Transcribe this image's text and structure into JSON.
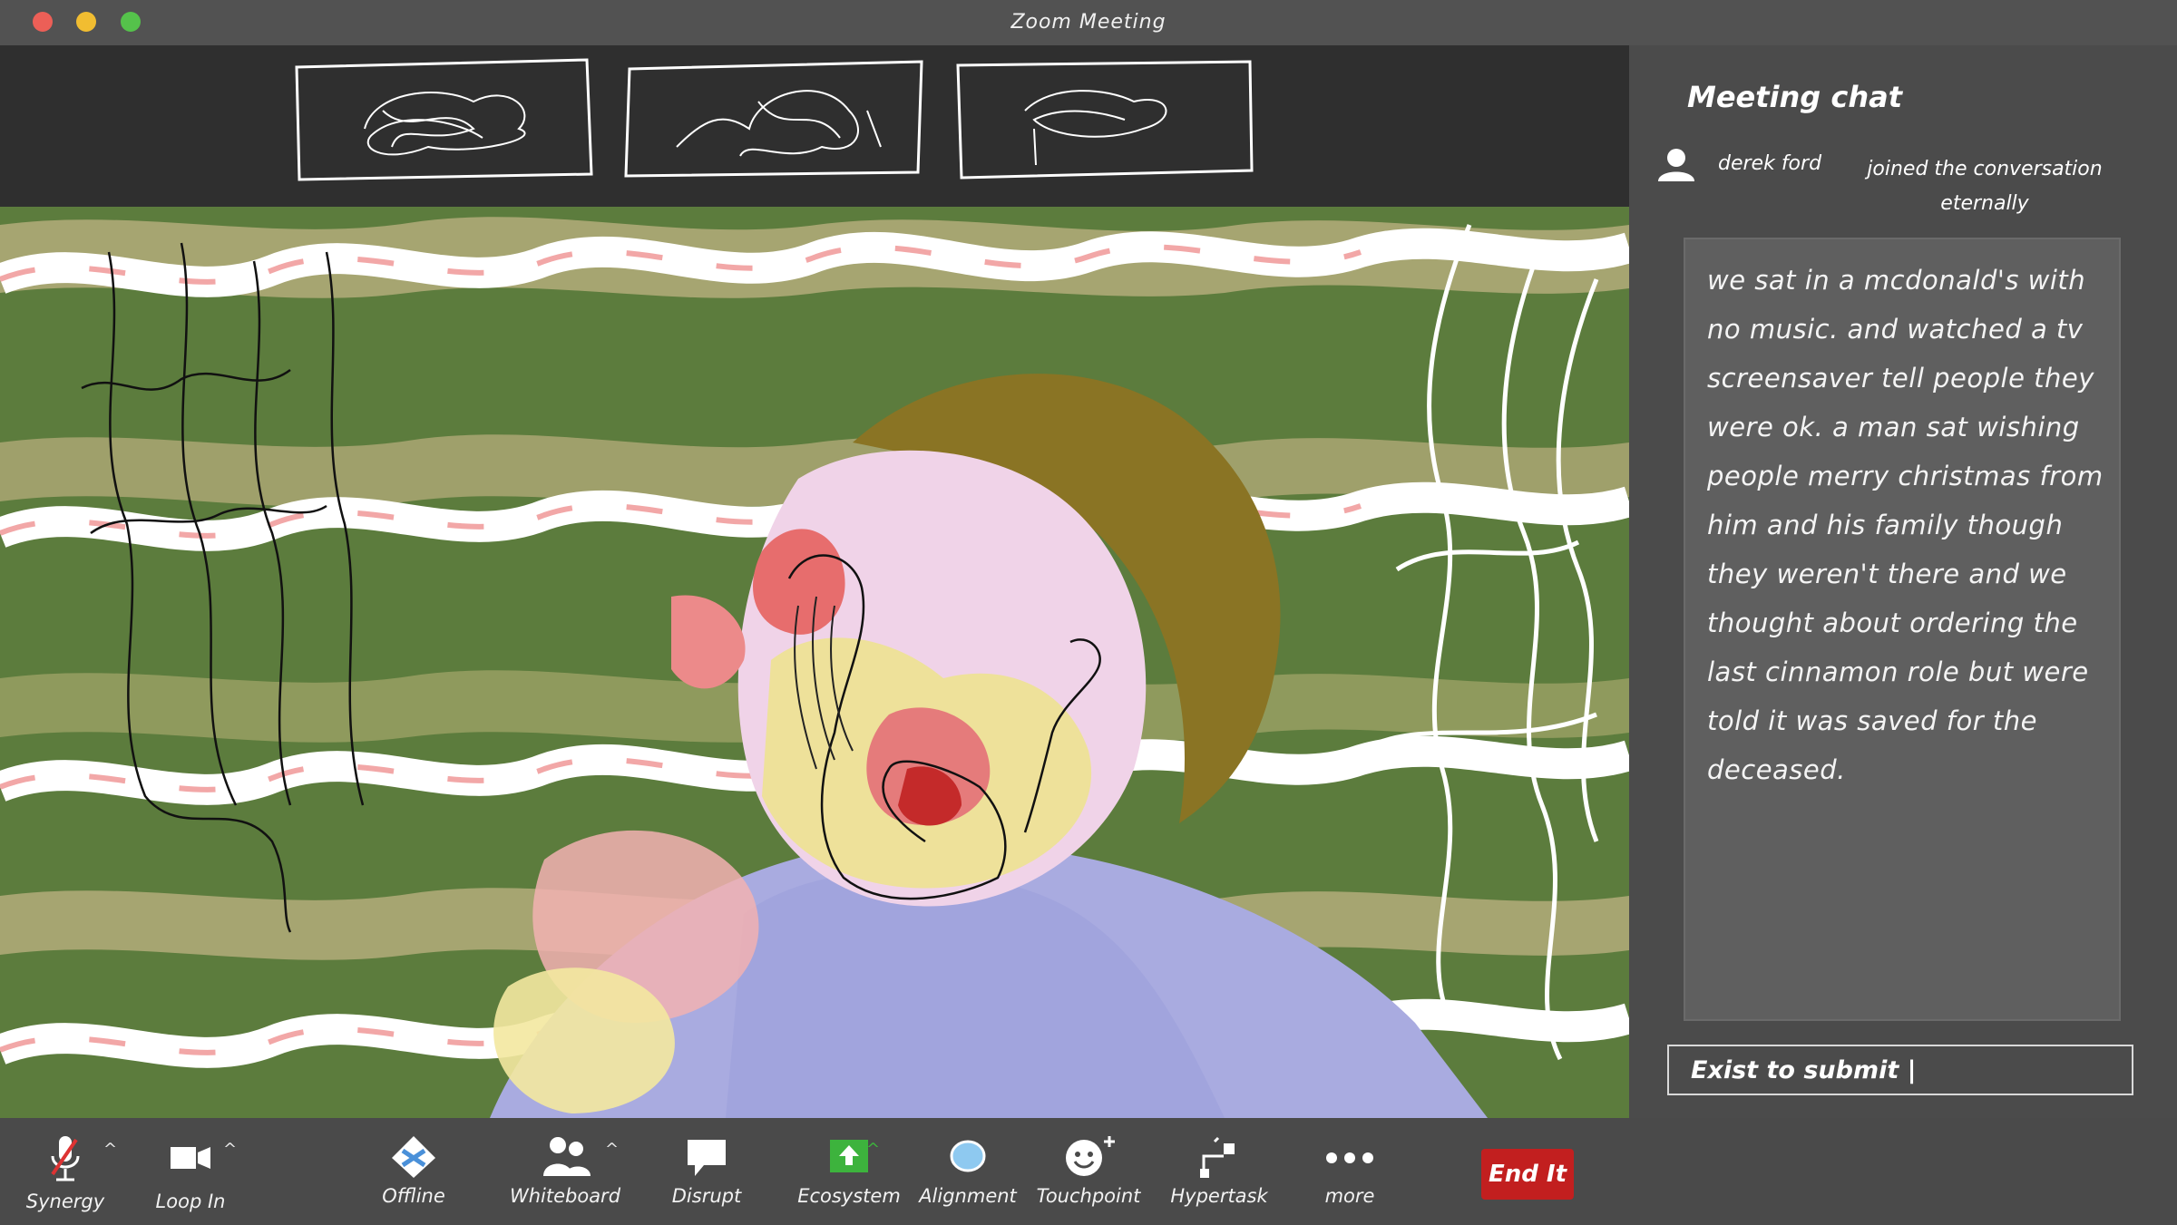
{
  "window": {
    "title": "Zoom Meeting"
  },
  "colors": {
    "end_button": "#c21f1f",
    "video_bg": "#5c7c3d",
    "chat_bg": "#4b4b4b",
    "message_box": "#5f5f5f"
  },
  "chat": {
    "title": "Meeting chat",
    "join_notice": {
      "name": "derek ford",
      "text": "joined the conversation eternally",
      "icon": "user-icon"
    },
    "message": "we sat in a mcdonald's with no music. and watched a tv screensaver tell people they were ok. a man sat wishing people merry christmas from him and his family though they weren't there and we thought about ordering the last cinnamon role but were told it was saved for the deceased.",
    "input": {
      "value": "Exist to submit |"
    }
  },
  "toolbar": {
    "items": [
      {
        "label": "Synergy",
        "icon": "microphone-muted-icon"
      },
      {
        "label": "Loop In",
        "icon": "video-camera-icon"
      },
      {
        "label": "Offline",
        "icon": "diamond-icon"
      },
      {
        "label": "Whiteboard",
        "icon": "participants-icon"
      },
      {
        "label": "Disrupt",
        "icon": "speech-bubble-icon"
      },
      {
        "label": "Ecosystem",
        "icon": "share-screen-icon"
      },
      {
        "label": "Alignment",
        "icon": "bubble-icon"
      },
      {
        "label": "Touchpoint",
        "icon": "reactions-icon"
      },
      {
        "label": "Hypertask",
        "icon": "hypertask-icon"
      },
      {
        "label": "more",
        "icon": "more-dots-icon"
      }
    ],
    "end_label": "End It"
  }
}
